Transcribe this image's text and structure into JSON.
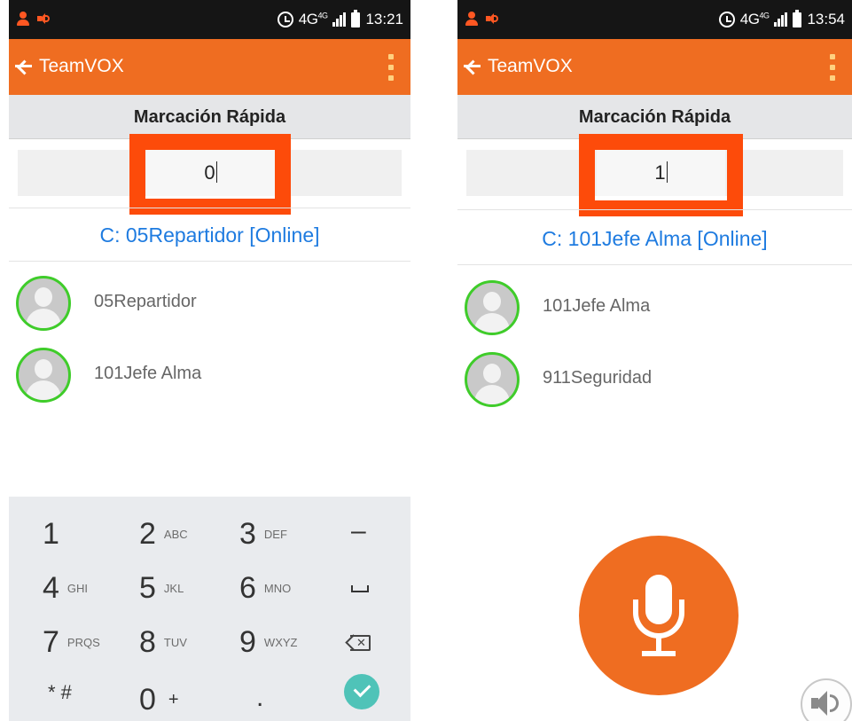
{
  "left_screen": {
    "status_bar": {
      "network": "4G",
      "network_sup": "4G",
      "time": "13:21"
    },
    "app_bar": {
      "title": "TeamVOX"
    },
    "title": "Marcación Rápida",
    "code_input": {
      "value": "0"
    },
    "current_contact": "C: 05Repartidor [Online]",
    "contacts": [
      {
        "name": "05Repartidor"
      },
      {
        "name": "101Jefe Alma"
      }
    ],
    "keypad": {
      "keys": [
        {
          "digit": "1",
          "letters": ""
        },
        {
          "digit": "2",
          "letters": "ABC"
        },
        {
          "digit": "3",
          "letters": "DEF"
        },
        {
          "digit": "4",
          "letters": "GHI"
        },
        {
          "digit": "5",
          "letters": "JKL"
        },
        {
          "digit": "6",
          "letters": "MNO"
        },
        {
          "digit": "7",
          "letters": "PRQS"
        },
        {
          "digit": "8",
          "letters": "TUV"
        },
        {
          "digit": "9",
          "letters": "WXYZ"
        },
        {
          "digit": "0",
          "letters": "+"
        }
      ],
      "dash": "–",
      "star_hash": "* #",
      "dot": "."
    }
  },
  "right_screen": {
    "status_bar": {
      "network": "4G",
      "network_sup": "4G",
      "time": "13:54"
    },
    "app_bar": {
      "title": "TeamVOX"
    },
    "title": "Marcación Rápida",
    "code_input": {
      "value": "1"
    },
    "current_contact": "C: 101Jefe Alma [Online]",
    "contacts": [
      {
        "name": "101Jefe Alma"
      },
      {
        "name": "911Seguridad"
      }
    ]
  },
  "colors": {
    "app_bar": "#ef6d21",
    "highlight_box": "#fd4b0a",
    "online_ring": "#3fcc2a",
    "current_contact_text": "#1e7be0",
    "done_key": "#4fc3b8"
  },
  "icons": [
    "person-notification-icon",
    "volume-icon",
    "alarm-icon",
    "signal-icon",
    "battery-icon",
    "back-arrow-icon",
    "overflow-menu-icon",
    "avatar-icon",
    "backspace-icon",
    "space-key-icon",
    "checkmark-icon",
    "microphone-icon",
    "speaker-icon"
  ]
}
